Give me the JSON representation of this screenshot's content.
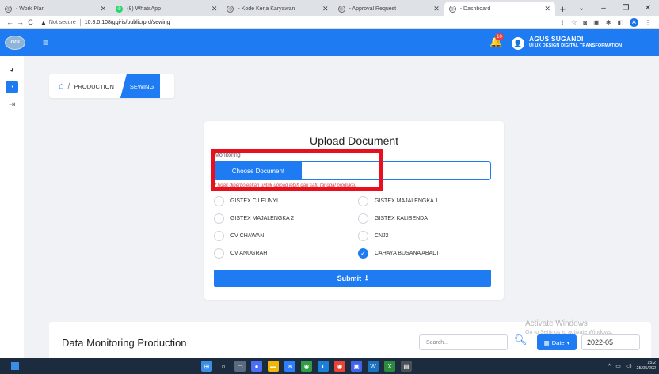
{
  "browser": {
    "tabs": [
      {
        "label": "- Work Plan",
        "icon": "globe-icon",
        "active": false
      },
      {
        "label": "(8) WhatsApp",
        "icon": "whatsapp-icon",
        "active": false
      },
      {
        "label": "- Kode Kerja Karyawan",
        "icon": "globe-icon",
        "active": false
      },
      {
        "label": "- Approval Request",
        "icon": "globe-icon",
        "active": false
      },
      {
        "label": "- Dashboard",
        "icon": "globe-icon",
        "active": true
      }
    ],
    "not_secure": "Not secure",
    "url": "10.8.0.108/ggi-is/public/prd/sewing",
    "profile_initial": "A"
  },
  "header": {
    "logo_text": "GGI",
    "notification_count": "10",
    "user_name": "AGUS SUGANDI",
    "user_role": "UI UX DESIGN DIGITAL TRANSFORMATION"
  },
  "breadcrumb": {
    "parent": "PRODUCTION",
    "current": "SEWING"
  },
  "upload": {
    "title": "Upload Document",
    "field_label": "Monitoring",
    "choose_label": "Choose Document",
    "hint": "*Tidak diperbolehkan untuk upload lebih dari satu tanggal produksi.",
    "options": [
      {
        "label": "GISTEX CILEUNYI",
        "checked": false
      },
      {
        "label": "GISTEX MAJALENGKA 1",
        "checked": false
      },
      {
        "label": "GISTEX MAJALENGKA 2",
        "checked": false
      },
      {
        "label": "GISTEX KALIBENDA",
        "checked": false
      },
      {
        "label": "CV CHAWAN",
        "checked": false
      },
      {
        "label": "CNJ2",
        "checked": false
      },
      {
        "label": "CV ANUGRAH",
        "checked": false
      },
      {
        "label": "CAHAYA BUSANA ABADI",
        "checked": true
      }
    ],
    "submit_label": "Submit"
  },
  "monitoring": {
    "title": "Data Monitoring Production",
    "search_placeholder": "Search...",
    "date_button": "Date",
    "date_value": "2022-05"
  },
  "watermark": {
    "line1": "Activate Windows",
    "line2": "Go to Settings to activate Windows."
  },
  "taskbar": {
    "time": "15:2",
    "date": "25/05/202"
  },
  "colors": {
    "primary": "#1e7bf2",
    "highlight": "#e8101f",
    "hint": "#d23b3b"
  }
}
